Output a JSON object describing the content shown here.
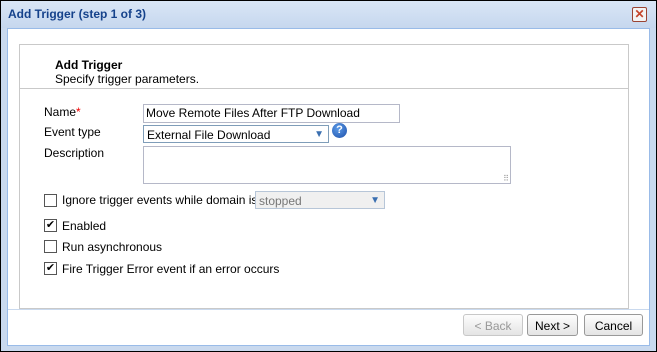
{
  "window": {
    "title": "Add Trigger (step 1 of 3)",
    "close_glyph": "✕"
  },
  "header": {
    "title": "Add Trigger",
    "subtitle": "Specify trigger parameters."
  },
  "form": {
    "name_label": "Name",
    "name_required_mark": "*",
    "name_value": "Move Remote Files After FTP Download",
    "event_type_label": "Event type",
    "event_type_value": "External File Download",
    "help_glyph": "?",
    "description_label": "Description",
    "description_value": "",
    "ignore_label": "Ignore trigger events while domain is",
    "ignore_checked": false,
    "domain_state_value": "stopped",
    "enabled_label": "Enabled",
    "enabled_checked": true,
    "async_label": "Run asynchronous",
    "async_checked": false,
    "fire_error_label": "Fire Trigger Error event if an error occurs",
    "fire_error_checked": true,
    "check_glyph": "✔"
  },
  "buttons": {
    "back": "< Back",
    "next": "Next >",
    "cancel": "Cancel"
  },
  "colors": {
    "title_text": "#15428b",
    "frame": "#c9d9ee",
    "required": "#ee0000"
  }
}
